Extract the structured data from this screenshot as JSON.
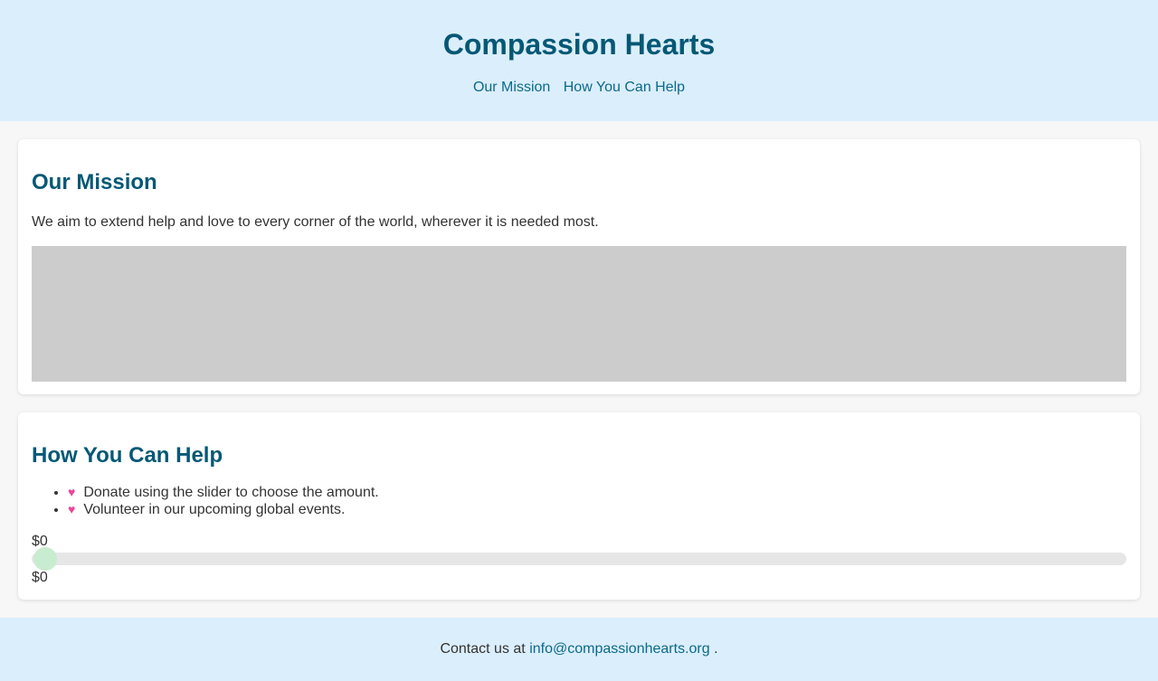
{
  "site": {
    "title": "Compassion Hearts"
  },
  "nav": {
    "items": [
      "Our Mission",
      "How You Can Help"
    ]
  },
  "mission": {
    "heading": "Our Mission",
    "text": "We aim to extend help and love to every corner of the world, wherever it is needed most."
  },
  "help": {
    "heading": "How You Can Help",
    "items": [
      "Donate using the slider to choose the amount.",
      "Volunteer in our upcoming global events."
    ],
    "bullet_icon": "heart-icon",
    "slider": {
      "amount_top": "$0",
      "amount_bottom": "$0",
      "value_fraction": 0
    }
  },
  "footer": {
    "prefix": "Contact us at",
    "email": "info@compassionhearts.org",
    "suffix": "."
  },
  "colors": {
    "header_bg": "#dbeefc",
    "heading": "#045875",
    "link": "#0a6a8a",
    "heart": "#e8479a",
    "slider_thumb": "#c8ecd0"
  }
}
